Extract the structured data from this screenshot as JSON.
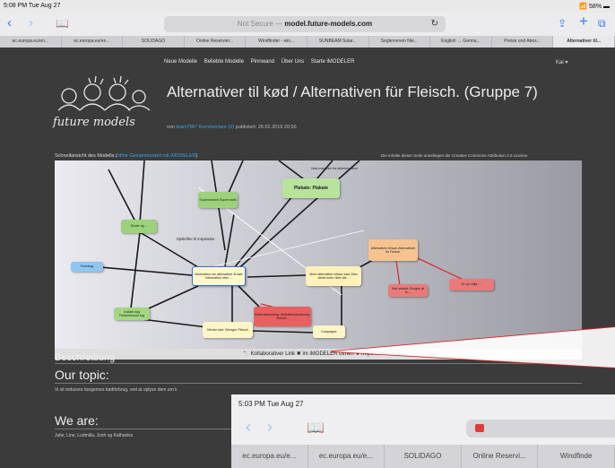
{
  "status_bar": {
    "time": "5:08 PM  Tue Aug 27",
    "battery": "58%"
  },
  "toolbar": {
    "url_prefix": "Not Secure — ",
    "url_host": "model.future-models.com",
    "reload_icon": "reload-icon",
    "share_icon": "share-icon",
    "add_icon": "plus-icon",
    "tabs_icon": "tabs-icon"
  },
  "tabs": [
    {
      "label": "ec.europa.eu/en..."
    },
    {
      "label": "ec.europa.eu/en..."
    },
    {
      "label": "SOLIDAGO"
    },
    {
      "label": "Online Reservier..."
    },
    {
      "label": "Windfinder - win..."
    },
    {
      "label": "SUNBEAM Solar..."
    },
    {
      "label": "Seglerverein Nie..."
    },
    {
      "label": "English ↔ Germa..."
    },
    {
      "label": "Preise und Abos..."
    },
    {
      "label": "Alternativer til...",
      "active": true
    }
  ],
  "site_nav": [
    "Neue Modelle",
    "Beliebte Modelle",
    "Pinnwand",
    "Über Uns",
    "Starte iMODELER"
  ],
  "user_menu": "Kai ▾",
  "logo_text": "future models",
  "page_title": "Alternativer til kød / Alternativen für Fleisch. (Gruppe 7)",
  "meta": {
    "prefix": "von",
    "author": "team78h*",
    "comments": "Kommentare (0)",
    "published": "publiziert: 26.02.2019 20:56"
  },
  "preview_note": {
    "text": "Schnellansicht des Modells (",
    "link": "öffne Gesamtmodell mit iMODELER",
    "suffix": ")"
  },
  "license_note": "Die Inhalte dieser Seite unterliegen der Creative Commons Attribution 3.0 License.",
  "diagram_footer": "🐩 Kollaborativer Link  ✖ im iMODELER öffnen  ⬇ Import Modell",
  "sections": {
    "besch": "Beschreibung",
    "topic_heading": "Our topic:",
    "topic_text": "Vi vil reducere borgernes kødforbrug, ved at oplyse dem om k",
    "weare_heading": "We are:",
    "weare_text": "Julie, Line, Ludmilla, Josh og Katharina"
  },
  "diagram_nodes": [
    {
      "id": "n1",
      "text": "Plakate: Plakate",
      "color": "#b7e39c"
    },
    {
      "id": "n2",
      "text": "Mad materiale fra tallerkenstand",
      "color": "#dcdce2"
    },
    {
      "id": "n3",
      "text": "Supermarked Supermarkt",
      "color": "#9bd27a"
    },
    {
      "id": "n4",
      "text": "Skoler og ...",
      "color": "#9bd27a"
    },
    {
      "id": "n5",
      "text": "Foredrag",
      "color": "#8ec6f0"
    },
    {
      "id": "n6",
      "text": "Information om alternativer til kød: Information über ...",
      "color": "#fff8c8"
    },
    {
      "id": "n7",
      "text": "Mere alternative mikser kød: Man denkt mehr über die...",
      "color": "#fff2b8"
    },
    {
      "id": "n8",
      "text": "Alternativer til kød: Alternativen für Fleisch.",
      "color": "#f6c38f"
    },
    {
      "id": "n9",
      "text": "Adfærdsændring: Verhaltensänderung, Verhalt...",
      "color": "#e86060"
    },
    {
      "id": "n10",
      "text": "Ikke ønsket: Brugen af to…",
      "color": "#ea7a7a"
    },
    {
      "id": "n11",
      "text": "Et nyt miljø: ...",
      "color": "#ea7a7a"
    },
    {
      "id": "n12",
      "text": "Indkøb dag Fleischbrauch tag",
      "color": "#a3d880"
    },
    {
      "id": "n13",
      "text": "Mindre kød: Weniger Fleisch",
      "color": "#fff6c8"
    },
    {
      "id": "n14",
      "text": "Kampagne",
      "color": "#fff6c8"
    },
    {
      "id": "n15",
      "text": "Opskrifter til inspiration",
      "color": "#dcdce2"
    }
  ],
  "shot2": {
    "time": "5:03 PM  Tue Aug 27",
    "tabs": [
      "ec.europa.eu/e...",
      "ec.europa.eu/e...",
      "SOLIDAGO",
      "Online Reservi...",
      "Windfinde"
    ]
  }
}
